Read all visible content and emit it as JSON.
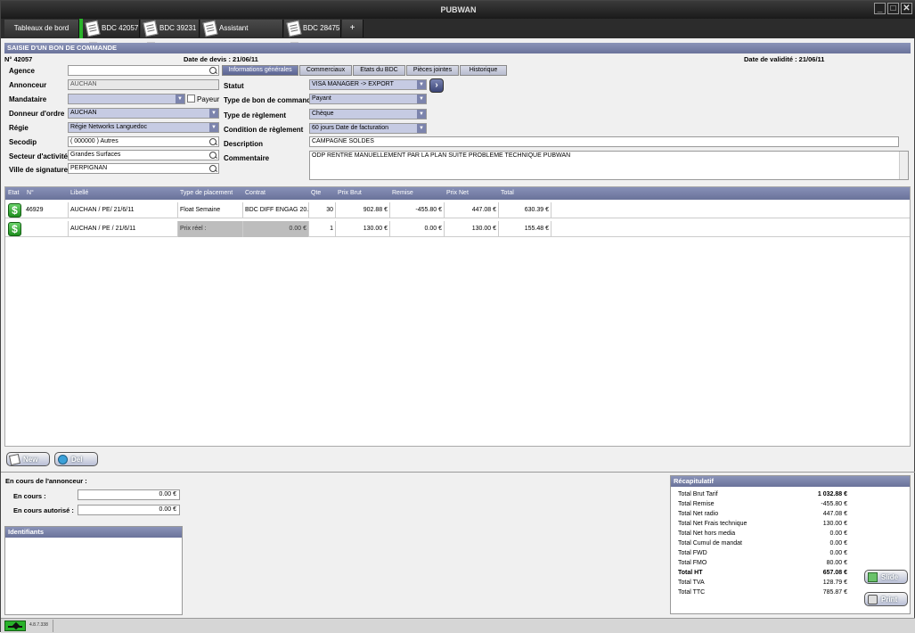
{
  "window": {
    "title": "PUBWAN"
  },
  "tabs": [
    {
      "label": "Tableaux de bord"
    },
    {
      "label": "BDC 42057"
    },
    {
      "label": "BDC 39231"
    },
    {
      "label": "Assistant campagne"
    },
    {
      "label": "BDC 28475"
    },
    {
      "label": "+"
    }
  ],
  "header": {
    "panel_title": "SAISIE D'UN BON DE COMMANDE",
    "number": "N° 42057",
    "quote_date": "Date de devis : 21/06/11",
    "validity_date": "Date de validité : 21/06/11"
  },
  "left_form": {
    "agence_label": "Agence",
    "agence_value": "",
    "annonceur_label": "Annonceur",
    "annonceur_value": "AUCHAN",
    "mandataire_label": "Mandataire",
    "mandataire_value": "",
    "payeur_label": "Payeur",
    "donneur_label": "Donneur d'ordre",
    "donneur_value": "AUCHAN",
    "regie_label": "Régie",
    "regie_value": "Régie Networks Languedoc",
    "secodip_label": "Secodip",
    "secodip_value": "( 000000 ) Autres",
    "secteur_label": "Secteur d'activité",
    "secteur_value": "Grandes Surfaces",
    "ville_label": "Ville de signature",
    "ville_value": "PERPIGNAN"
  },
  "form_tabs": [
    {
      "label": "Informations générales"
    },
    {
      "label": "Commerciaux"
    },
    {
      "label": "Etats du BDC"
    },
    {
      "label": "Pièces jointes"
    },
    {
      "label": "Historique"
    }
  ],
  "right_form": {
    "statut_label": "Statut",
    "statut_value": "VISA MANAGER -> EXPORT",
    "type_bdc_label": "Type de bon de commande",
    "type_bdc_value": "Payant",
    "type_reg_label": "Type de règlement",
    "type_reg_value": "Chèque",
    "cond_label": "Condition de règlement",
    "cond_value": "60 jours Date de facturation",
    "desc_label": "Description",
    "desc_value": "CAMPAGNE SOLDES",
    "comment_label": "Commentaire",
    "comment_value": "ODP RENTRE MANUELLEMENT PAR LA PLAN SUITE PROBLEME TECHNIQUE PUBWAN"
  },
  "grid": {
    "columns": [
      "Etat",
      "N°",
      "Libellé",
      "Type de placement",
      "Contrat",
      "Qte",
      "Prix Brut",
      "Remise",
      "Prix Net",
      "Total"
    ],
    "rows": [
      {
        "num": "46929",
        "libelle": "AUCHAN / PE/ 21/6/11",
        "type": "Float Semaine",
        "contrat": "BDC DIFF ENGAG 20...",
        "qte": "30",
        "brut": "902.88 €",
        "remise": "-455.80 €",
        "net": "447.08 €",
        "total": "630.39 €"
      },
      {
        "num": "",
        "libelle": "AUCHAN / PE / 21/6/11",
        "type": "Prix réel :",
        "contrat": "0.00 €",
        "qte": "1",
        "brut": "130.00 €",
        "remise": "0.00 €",
        "net": "130.00 €",
        "total": "155.48 €"
      }
    ]
  },
  "actions": {
    "new_label": "New",
    "del_label": "Del"
  },
  "encours": {
    "title": "En cours de l'annonceur :",
    "en_cours_label": "En cours :",
    "en_cours_value": "0.00 €",
    "autorise_label": "En cours autorisé :",
    "autorise_value": "0.00 €"
  },
  "identifiants": {
    "title": "Identifiants"
  },
  "recap": {
    "title": "Récapitulatif",
    "rows": [
      {
        "label": "Total Brut Tarif",
        "value": "1 032.88 €",
        "bold": true
      },
      {
        "label": "Total Remise",
        "value": "-455.80 €"
      },
      {
        "label": "Total Net radio",
        "value": "447.08 €"
      },
      {
        "label": "Total Net Frais technique",
        "value": "130.00 €"
      },
      {
        "label": "Total Net hors media",
        "value": "0.00 €"
      },
      {
        "label": "Total Cumul de mandat",
        "value": "0.00 €"
      },
      {
        "label": "Total FWD",
        "value": "0.00 €"
      },
      {
        "label": "Total FMO",
        "value": "80.00 €"
      },
      {
        "label": "Total HT",
        "value": "657.08 €",
        "bold": true
      },
      {
        "label": "Total TVA",
        "value": "128.79 €"
      },
      {
        "label": "Total TTC",
        "value": "785.87 €"
      }
    ],
    "slide_label": "Slide",
    "print_label": "Print"
  },
  "status": {
    "version": "4.8.7.338"
  },
  "colors": {
    "accent": "#6a739a",
    "tab_bg": "#2c2c2c",
    "status_ok": "#29b32a"
  }
}
